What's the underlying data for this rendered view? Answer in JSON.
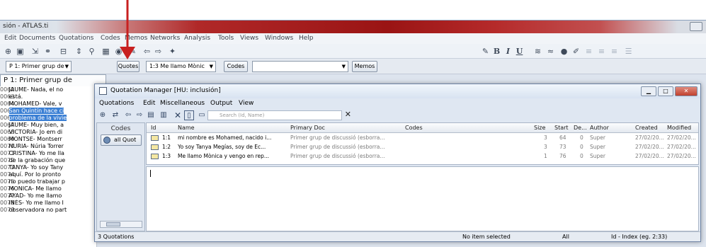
{
  "app": {
    "title": "sión - ATLAS.ti",
    "menu": [
      "Edit",
      "Documents",
      "Quotations",
      "Codes",
      "Memos",
      "Networks",
      "Analysis",
      "Tools",
      "Views",
      "Windows",
      "Help"
    ]
  },
  "toolbar": {
    "bold": "B",
    "italic": "I",
    "underline": "U"
  },
  "toolbar2": {
    "p_doc_select": "P 1: Primer grup de",
    "quotes_button": "Quotes",
    "quote_select": "1:3 Me llamo Mònic",
    "codes_button": "Codes",
    "codes_select": "",
    "memos_button": "Memos"
  },
  "document": {
    "tab": "P 1: Primer grup de",
    "lines": [
      {
        "num": "0062",
        "text": "JAUME- Nada, el no",
        "highlight": false
      },
      {
        "num": "0063",
        "text": "está.",
        "highlight": false
      },
      {
        "num": "0064",
        "text": "MOHAMED- Vale, v",
        "highlight": false
      },
      {
        "num": "0065",
        "text": "San Quintín hace ci",
        "highlight": true
      },
      {
        "num": "0066",
        "text": "problema de la vivie",
        "highlight": true
      },
      {
        "num": "0067",
        "text": "JAUME- Muy bien, a",
        "highlight": false
      },
      {
        "num": "0068",
        "text": "VICTORIA- Jo em di",
        "highlight": false
      },
      {
        "num": "0069",
        "text": "MONTSE- Montserr",
        "highlight": false
      },
      {
        "num": "0070",
        "text": "NURIA- Núria Torrer",
        "highlight": false
      },
      {
        "num": "0071",
        "text": "CRISTINA- Yo me lla",
        "highlight": false
      },
      {
        "num": "0072",
        "text": "de la grabación que",
        "highlight": false
      },
      {
        "num": "0073",
        "text": "TANYA- Yo soy Tany",
        "highlight": false
      },
      {
        "num": "0074",
        "text": "aquí. Por lo pronto",
        "highlight": false
      },
      {
        "num": "0075",
        "text": "no puedo trabajar p",
        "highlight": false
      },
      {
        "num": "0076",
        "text": "MONICA- Me llamo",
        "highlight": false
      },
      {
        "num": "0077",
        "text": "AYAD- Yo me llamo",
        "highlight": false
      },
      {
        "num": "0078",
        "text": "INÉS- Yo me llamo I",
        "highlight": false
      },
      {
        "num": "0079",
        "text": "observadora no part",
        "highlight": false
      }
    ]
  },
  "quotation_manager": {
    "title": "Quotation Manager [HU: inclusión]",
    "menu": [
      "Quotations",
      "Edit",
      "Miscellaneous",
      "Output",
      "View"
    ],
    "search_placeholder": "Search (Id, Name)",
    "clear_search": "✕",
    "codes_header": "Codes",
    "all_quotes_button": "all Quot",
    "columns": [
      "Id",
      "Name",
      "Primary Doc",
      "Codes",
      "Size",
      "Start",
      "De...",
      "Author",
      "Created",
      "Modified"
    ],
    "rows": [
      {
        "id": "1:1",
        "name": "mi nombre es Mohamed, nacido i...",
        "primary_doc": "Primer grup de discussió (esborra...",
        "codes": "",
        "size": "3",
        "start": "64",
        "density": "0",
        "author": "Super",
        "created": "27/02/20...",
        "modified": "27/02/20..."
      },
      {
        "id": "1:2",
        "name": "Yo soy Tanya Megías, soy de Ec...",
        "primary_doc": "Primer grup de discussió (esborra...",
        "codes": "",
        "size": "3",
        "start": "73",
        "density": "0",
        "author": "Super",
        "created": "27/02/20...",
        "modified": "27/02/20..."
      },
      {
        "id": "1:3",
        "name": "Me llamo Mònica y vengo en rep...",
        "primary_doc": "Primer grup de discussió (esborra...",
        "codes": "",
        "size": "1",
        "start": "76",
        "density": "0",
        "author": "Super",
        "created": "27/02/20...",
        "modified": "27/02/20..."
      }
    ],
    "status": {
      "count": "3 Quotations",
      "selection": "No item selected",
      "filter": "All",
      "sort": "Id - Index (eg. 2:33)"
    }
  },
  "colors": {
    "annotation_arrow": "#c82020",
    "selection_highlight": "#3a7fd4"
  }
}
